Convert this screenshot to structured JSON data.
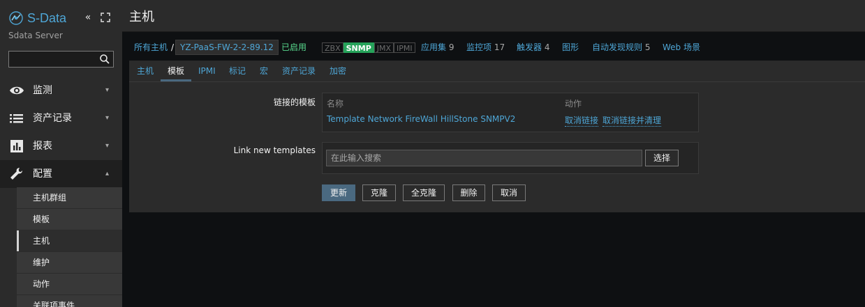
{
  "brand": {
    "name": "S-Data",
    "server": "Sdata Server",
    "accent": "#4ea6d6"
  },
  "sidebar": {
    "search": {
      "value": "",
      "placeholder": ""
    },
    "nav": [
      {
        "label": "监测",
        "icon": "eye-icon",
        "expanded": false
      },
      {
        "label": "资产记录",
        "icon": "list-icon",
        "expanded": false
      },
      {
        "label": "报表",
        "icon": "bar-chart-icon",
        "expanded": false
      },
      {
        "label": "配置",
        "icon": "wrench-icon",
        "expanded": true
      }
    ],
    "sub": [
      {
        "label": "主机群组"
      },
      {
        "label": "模板"
      },
      {
        "label": "主机"
      },
      {
        "label": "维护"
      },
      {
        "label": "动作"
      },
      {
        "label": "关联项事件"
      }
    ]
  },
  "header": {
    "title": "主机"
  },
  "breadcrumb": {
    "all_hosts": "所有主机",
    "separator": "/",
    "host": "YZ-PaaS-FW-2-2-89.12",
    "status": "已启用",
    "availability": [
      {
        "label": "ZBX",
        "active": false
      },
      {
        "label": "SNMP",
        "active": true
      },
      {
        "label": "JMX",
        "active": false
      },
      {
        "label": "IPMI",
        "active": false
      }
    ],
    "links": [
      {
        "label": "应用集",
        "count": "9"
      },
      {
        "label": "监控项",
        "count": "17"
      },
      {
        "label": "触发器",
        "count": "4"
      },
      {
        "label": "图形",
        "count": ""
      },
      {
        "label": "自动发现规则",
        "count": "5"
      },
      {
        "label": "Web 场景",
        "count": ""
      }
    ]
  },
  "tabs": [
    {
      "label": "主机",
      "selected": false
    },
    {
      "label": "模板",
      "selected": true
    },
    {
      "label": "IPMI",
      "selected": false
    },
    {
      "label": "标记",
      "selected": false
    },
    {
      "label": "宏",
      "selected": false
    },
    {
      "label": "资产记录",
      "selected": false
    },
    {
      "label": "加密",
      "selected": false
    }
  ],
  "form": {
    "linked_label": "链接的模板",
    "col_name": "名称",
    "col_action": "动作",
    "linked_template": "Template Network FireWall HillStone SNMPV2",
    "unlink": "取消链接",
    "unlink_clear": "取消链接并清理",
    "new_label": "Link new templates",
    "new_placeholder": "在此输入搜索",
    "select_button": "选择"
  },
  "buttons": {
    "update": "更新",
    "clone": "克隆",
    "full_clone": "全克隆",
    "delete": "删除",
    "cancel": "取消"
  }
}
